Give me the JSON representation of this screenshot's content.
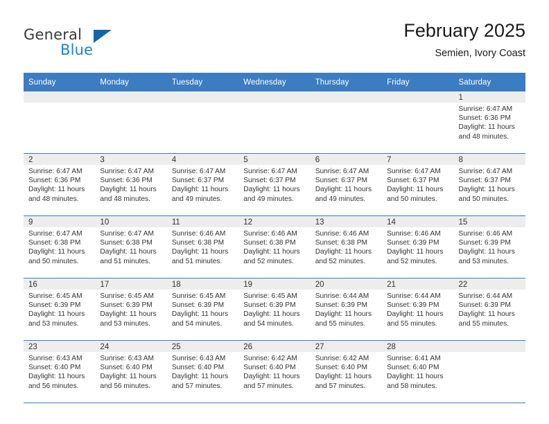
{
  "brand": {
    "name_part1": "General",
    "name_part2": "Blue",
    "triangle_icon": "triangle-icon",
    "accent_color": "#1c82d2",
    "triangle_color": "#1565a8"
  },
  "header": {
    "month_title": "February 2025",
    "location": "Semien, Ivory Coast"
  },
  "calendar": {
    "header_color": "#3b7dc0",
    "numband_color": "#ededed",
    "weekday_headers": [
      "Sunday",
      "Monday",
      "Tuesday",
      "Wednesday",
      "Thursday",
      "Friday",
      "Saturday"
    ],
    "weeks": [
      [
        {
          "day": "",
          "sunrise": "",
          "sunset": "",
          "daylight_line1": "",
          "daylight_line2": "",
          "empty": true
        },
        {
          "day": "",
          "sunrise": "",
          "sunset": "",
          "daylight_line1": "",
          "daylight_line2": "",
          "empty": true
        },
        {
          "day": "",
          "sunrise": "",
          "sunset": "",
          "daylight_line1": "",
          "daylight_line2": "",
          "empty": true
        },
        {
          "day": "",
          "sunrise": "",
          "sunset": "",
          "daylight_line1": "",
          "daylight_line2": "",
          "empty": true
        },
        {
          "day": "",
          "sunrise": "",
          "sunset": "",
          "daylight_line1": "",
          "daylight_line2": "",
          "empty": true
        },
        {
          "day": "",
          "sunrise": "",
          "sunset": "",
          "daylight_line1": "",
          "daylight_line2": "",
          "empty": true
        },
        {
          "day": "1",
          "sunrise": "Sunrise: 6:47 AM",
          "sunset": "Sunset: 6:36 PM",
          "daylight_line1": "Daylight: 11 hours",
          "daylight_line2": "and 48 minutes.",
          "empty": false
        }
      ],
      [
        {
          "day": "2",
          "sunrise": "Sunrise: 6:47 AM",
          "sunset": "Sunset: 6:36 PM",
          "daylight_line1": "Daylight: 11 hours",
          "daylight_line2": "and 48 minutes.",
          "empty": false
        },
        {
          "day": "3",
          "sunrise": "Sunrise: 6:47 AM",
          "sunset": "Sunset: 6:36 PM",
          "daylight_line1": "Daylight: 11 hours",
          "daylight_line2": "and 48 minutes.",
          "empty": false
        },
        {
          "day": "4",
          "sunrise": "Sunrise: 6:47 AM",
          "sunset": "Sunset: 6:37 PM",
          "daylight_line1": "Daylight: 11 hours",
          "daylight_line2": "and 49 minutes.",
          "empty": false
        },
        {
          "day": "5",
          "sunrise": "Sunrise: 6:47 AM",
          "sunset": "Sunset: 6:37 PM",
          "daylight_line1": "Daylight: 11 hours",
          "daylight_line2": "and 49 minutes.",
          "empty": false
        },
        {
          "day": "6",
          "sunrise": "Sunrise: 6:47 AM",
          "sunset": "Sunset: 6:37 PM",
          "daylight_line1": "Daylight: 11 hours",
          "daylight_line2": "and 49 minutes.",
          "empty": false
        },
        {
          "day": "7",
          "sunrise": "Sunrise: 6:47 AM",
          "sunset": "Sunset: 6:37 PM",
          "daylight_line1": "Daylight: 11 hours",
          "daylight_line2": "and 50 minutes.",
          "empty": false
        },
        {
          "day": "8",
          "sunrise": "Sunrise: 6:47 AM",
          "sunset": "Sunset: 6:37 PM",
          "daylight_line1": "Daylight: 11 hours",
          "daylight_line2": "and 50 minutes.",
          "empty": false
        }
      ],
      [
        {
          "day": "9",
          "sunrise": "Sunrise: 6:47 AM",
          "sunset": "Sunset: 6:38 PM",
          "daylight_line1": "Daylight: 11 hours",
          "daylight_line2": "and 50 minutes.",
          "empty": false
        },
        {
          "day": "10",
          "sunrise": "Sunrise: 6:47 AM",
          "sunset": "Sunset: 6:38 PM",
          "daylight_line1": "Daylight: 11 hours",
          "daylight_line2": "and 51 minutes.",
          "empty": false
        },
        {
          "day": "11",
          "sunrise": "Sunrise: 6:46 AM",
          "sunset": "Sunset: 6:38 PM",
          "daylight_line1": "Daylight: 11 hours",
          "daylight_line2": "and 51 minutes.",
          "empty": false
        },
        {
          "day": "12",
          "sunrise": "Sunrise: 6:46 AM",
          "sunset": "Sunset: 6:38 PM",
          "daylight_line1": "Daylight: 11 hours",
          "daylight_line2": "and 52 minutes.",
          "empty": false
        },
        {
          "day": "13",
          "sunrise": "Sunrise: 6:46 AM",
          "sunset": "Sunset: 6:38 PM",
          "daylight_line1": "Daylight: 11 hours",
          "daylight_line2": "and 52 minutes.",
          "empty": false
        },
        {
          "day": "14",
          "sunrise": "Sunrise: 6:46 AM",
          "sunset": "Sunset: 6:39 PM",
          "daylight_line1": "Daylight: 11 hours",
          "daylight_line2": "and 52 minutes.",
          "empty": false
        },
        {
          "day": "15",
          "sunrise": "Sunrise: 6:46 AM",
          "sunset": "Sunset: 6:39 PM",
          "daylight_line1": "Daylight: 11 hours",
          "daylight_line2": "and 53 minutes.",
          "empty": false
        }
      ],
      [
        {
          "day": "16",
          "sunrise": "Sunrise: 6:45 AM",
          "sunset": "Sunset: 6:39 PM",
          "daylight_line1": "Daylight: 11 hours",
          "daylight_line2": "and 53 minutes.",
          "empty": false
        },
        {
          "day": "17",
          "sunrise": "Sunrise: 6:45 AM",
          "sunset": "Sunset: 6:39 PM",
          "daylight_line1": "Daylight: 11 hours",
          "daylight_line2": "and 53 minutes.",
          "empty": false
        },
        {
          "day": "18",
          "sunrise": "Sunrise: 6:45 AM",
          "sunset": "Sunset: 6:39 PM",
          "daylight_line1": "Daylight: 11 hours",
          "daylight_line2": "and 54 minutes.",
          "empty": false
        },
        {
          "day": "19",
          "sunrise": "Sunrise: 6:45 AM",
          "sunset": "Sunset: 6:39 PM",
          "daylight_line1": "Daylight: 11 hours",
          "daylight_line2": "and 54 minutes.",
          "empty": false
        },
        {
          "day": "20",
          "sunrise": "Sunrise: 6:44 AM",
          "sunset": "Sunset: 6:39 PM",
          "daylight_line1": "Daylight: 11 hours",
          "daylight_line2": "and 55 minutes.",
          "empty": false
        },
        {
          "day": "21",
          "sunrise": "Sunrise: 6:44 AM",
          "sunset": "Sunset: 6:39 PM",
          "daylight_line1": "Daylight: 11 hours",
          "daylight_line2": "and 55 minutes.",
          "empty": false
        },
        {
          "day": "22",
          "sunrise": "Sunrise: 6:44 AM",
          "sunset": "Sunset: 6:39 PM",
          "daylight_line1": "Daylight: 11 hours",
          "daylight_line2": "and 55 minutes.",
          "empty": false
        }
      ],
      [
        {
          "day": "23",
          "sunrise": "Sunrise: 6:43 AM",
          "sunset": "Sunset: 6:40 PM",
          "daylight_line1": "Daylight: 11 hours",
          "daylight_line2": "and 56 minutes.",
          "empty": false
        },
        {
          "day": "24",
          "sunrise": "Sunrise: 6:43 AM",
          "sunset": "Sunset: 6:40 PM",
          "daylight_line1": "Daylight: 11 hours",
          "daylight_line2": "and 56 minutes.",
          "empty": false
        },
        {
          "day": "25",
          "sunrise": "Sunrise: 6:43 AM",
          "sunset": "Sunset: 6:40 PM",
          "daylight_line1": "Daylight: 11 hours",
          "daylight_line2": "and 57 minutes.",
          "empty": false
        },
        {
          "day": "26",
          "sunrise": "Sunrise: 6:42 AM",
          "sunset": "Sunset: 6:40 PM",
          "daylight_line1": "Daylight: 11 hours",
          "daylight_line2": "and 57 minutes.",
          "empty": false
        },
        {
          "day": "27",
          "sunrise": "Sunrise: 6:42 AM",
          "sunset": "Sunset: 6:40 PM",
          "daylight_line1": "Daylight: 11 hours",
          "daylight_line2": "and 57 minutes.",
          "empty": false
        },
        {
          "day": "28",
          "sunrise": "Sunrise: 6:41 AM",
          "sunset": "Sunset: 6:40 PM",
          "daylight_line1": "Daylight: 11 hours",
          "daylight_line2": "and 58 minutes.",
          "empty": false
        },
        {
          "day": "",
          "sunrise": "",
          "sunset": "",
          "daylight_line1": "",
          "daylight_line2": "",
          "empty": true
        }
      ]
    ]
  }
}
